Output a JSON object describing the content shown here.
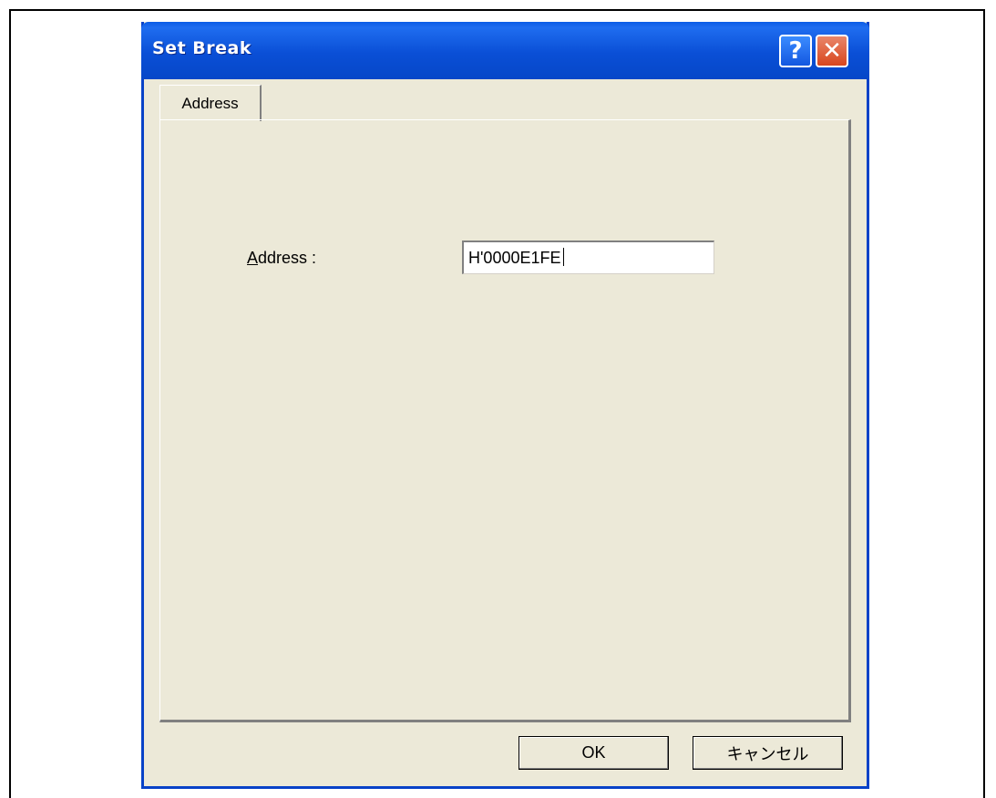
{
  "window": {
    "title": "Set Break",
    "help_glyph": "?",
    "close_glyph": "✕"
  },
  "tabs": [
    {
      "label": "Address",
      "selected": true
    }
  ],
  "form": {
    "address_label_accel": "A",
    "address_label_rest": "ddress :",
    "address_value": "H'0000E1FE"
  },
  "buttons": {
    "ok_label": "OK",
    "cancel_label": "キャンセル"
  },
  "colors": {
    "titlebar": "#0a4fd6",
    "dialog_bg": "#ece9d8",
    "close_button": "#d8461e"
  }
}
